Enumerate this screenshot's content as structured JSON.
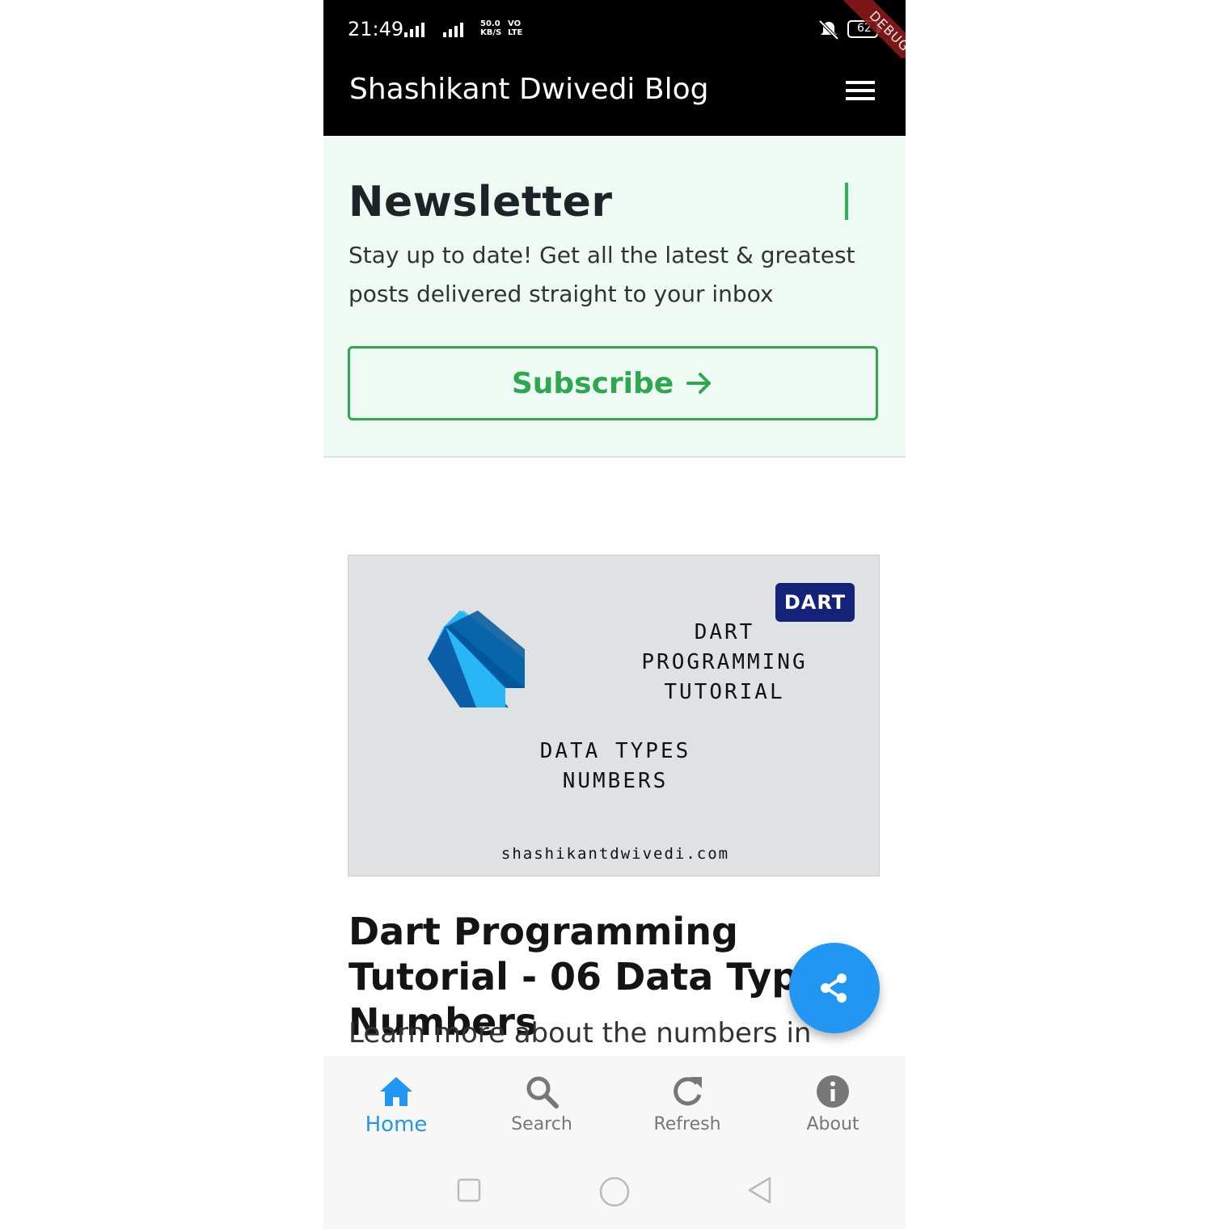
{
  "status_bar": {
    "time": "21:49",
    "speed_value": "50.0",
    "speed_unit": "KB/S",
    "volte_top": "VO",
    "volte_bottom": "LTE",
    "battery": "62",
    "debug_label": "DEBUG"
  },
  "app_bar": {
    "title": "Shashikant Dwivedi Blog",
    "menu_icon": "hamburger-menu-icon"
  },
  "newsletter": {
    "title": "Newsletter",
    "description": "Stay up to date! Get all the latest & greatest posts delivered straight to your inbox",
    "subscribe_label": "Subscribe",
    "accent": "#2ea84f",
    "background": "#eefaf3"
  },
  "post": {
    "image": {
      "badge": "DART",
      "heading_lines": [
        "DART",
        "PROGRAMMING",
        "TUTORIAL"
      ],
      "topic_lines": [
        "DATA TYPES",
        "NUMBERS"
      ],
      "site": "shashikantdwivedi.com"
    },
    "title": "Dart Programming Tutorial - 06 Data Types - Numbers",
    "excerpt": "Learn more about the numbers in"
  },
  "fab": {
    "icon": "share-icon",
    "color": "#2196f3"
  },
  "bottom_nav": {
    "items": [
      {
        "label": "Home",
        "icon": "home-icon",
        "active": true
      },
      {
        "label": "Search",
        "icon": "search-icon",
        "active": false
      },
      {
        "label": "Refresh",
        "icon": "refresh-icon",
        "active": false
      },
      {
        "label": "About",
        "icon": "info-icon",
        "active": false
      }
    ],
    "active_color": "#2196f3"
  }
}
